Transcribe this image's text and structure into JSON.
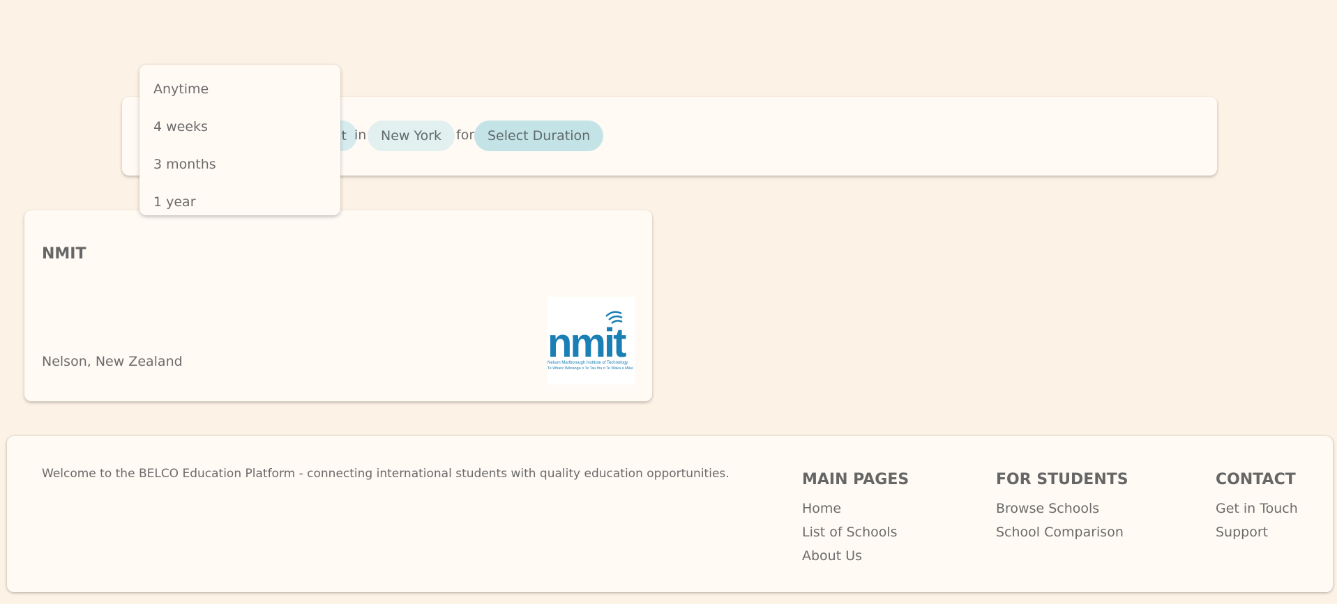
{
  "search": {
    "hidden_chip_tail": "t",
    "connector_in": "in",
    "location": "New York",
    "connector_for": "for",
    "duration_placeholder": "Select Duration"
  },
  "duration_dropdown": {
    "options": [
      "Anytime",
      "4 weeks",
      "3 months",
      "1 year"
    ]
  },
  "school_card": {
    "name": "NMIT",
    "location": "Nelson, New Zealand",
    "logo": {
      "wordmark": "nmit",
      "line1": "Nelson Marlborough Institute of Technology",
      "line2": "Te Whare Wānanga o Te Tau Ihu o Te Waka a Māui",
      "color": "#1a7fb5"
    }
  },
  "footer": {
    "tagline": "Welcome to the BELCO Education Platform - connecting international students with quality education opportunities.",
    "main_pages": {
      "heading": "MAIN PAGES",
      "links": [
        "Home",
        "List of Schools",
        "About Us"
      ]
    },
    "for_students": {
      "heading": "FOR STUDENTS",
      "links": [
        "Browse Schools",
        "School Comparison"
      ]
    },
    "contact": {
      "heading": "CONTACT",
      "links": [
        "Get in Touch",
        "Support"
      ]
    }
  },
  "colors": {
    "page_background": "#fdf2e6",
    "card_background": "#fffaf4",
    "chip_location": "#e3f0f0",
    "chip_duration": "#c4e3e7",
    "text": "#6b6b6b"
  }
}
